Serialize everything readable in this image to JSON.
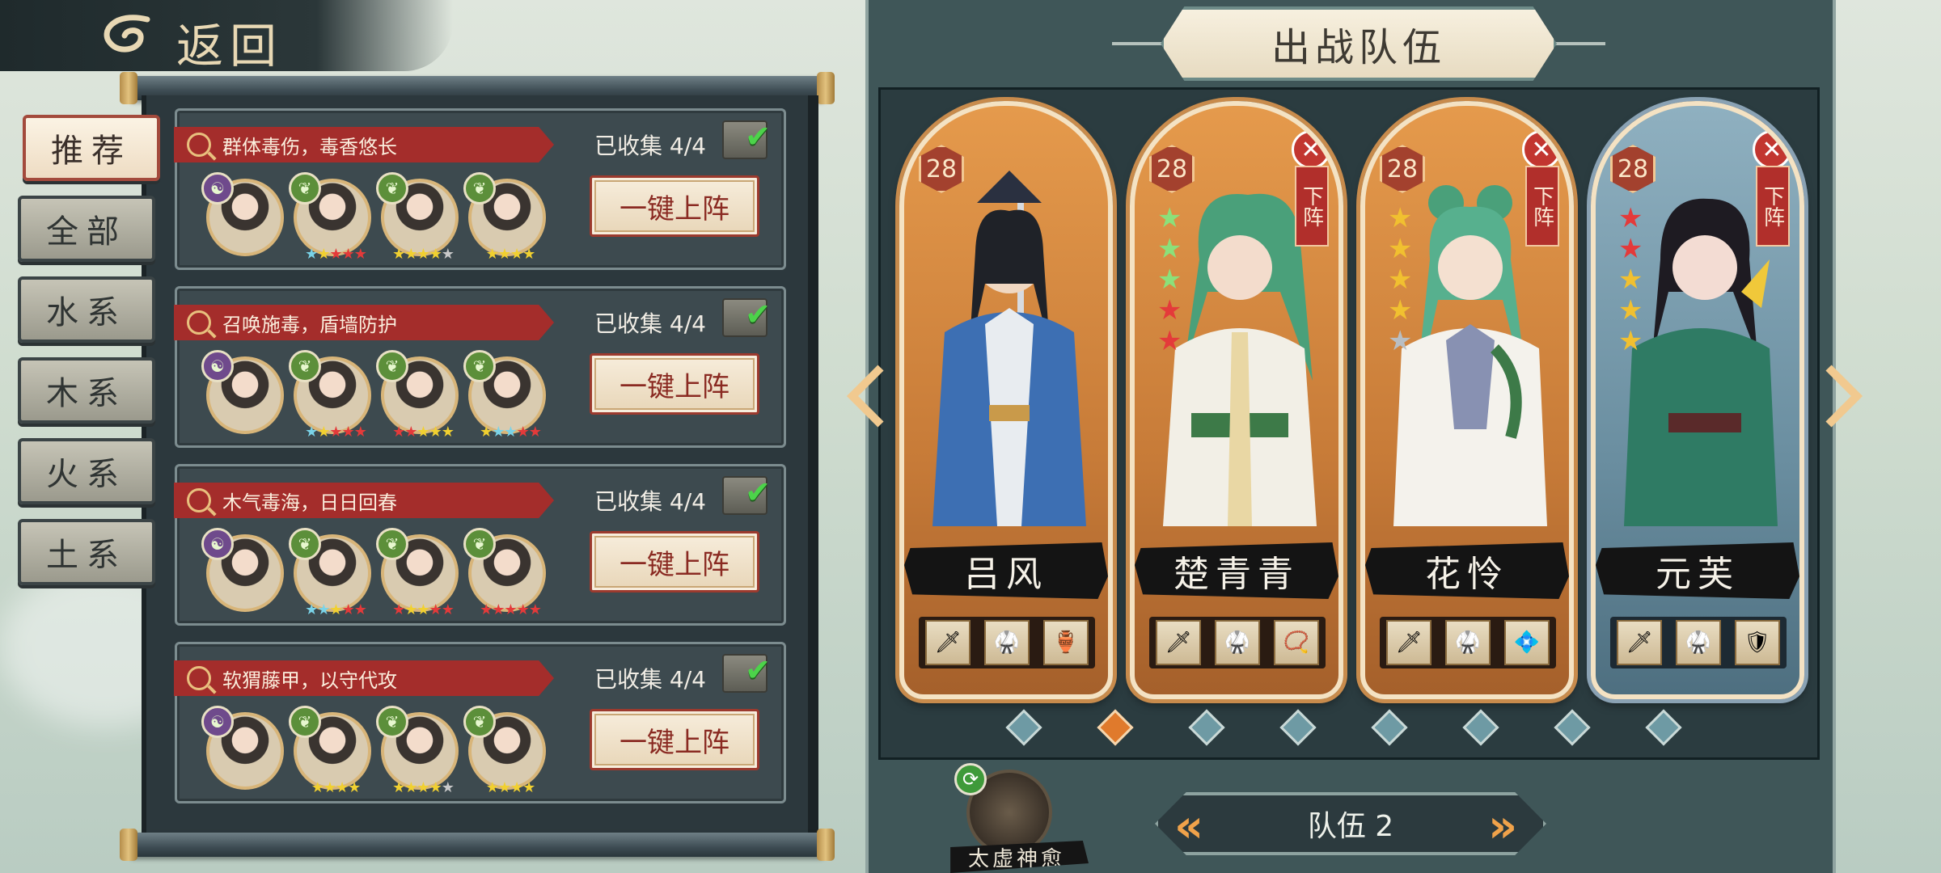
{
  "header": {
    "back_label": "返回"
  },
  "tabs": [
    {
      "label": "推荐",
      "active": true
    },
    {
      "label": "全部"
    },
    {
      "label": "水系"
    },
    {
      "label": "木系"
    },
    {
      "label": "火系"
    },
    {
      "label": "土系"
    }
  ],
  "teams": [
    {
      "title": "群体毒伤，毒香悠长",
      "collected": "已收集 4/4",
      "button": "一键上阵"
    },
    {
      "title": "召唤施毒，盾墙防护",
      "collected": "已收集 4/4",
      "button": "一键上阵"
    },
    {
      "title": "木气毒海，日日回春",
      "collected": "已收集 4/4",
      "button": "一键上阵"
    },
    {
      "title": "软猬藤甲，以守代攻",
      "collected": "已收集 4/4",
      "button": "一键上阵"
    }
  ],
  "formation": {
    "title": "出战队伍",
    "remove_label": "下阵",
    "characters": [
      {
        "name": "吕风",
        "level": "28",
        "removable": false,
        "theme": "orange"
      },
      {
        "name": "楚青青",
        "level": "28",
        "removable": true,
        "theme": "orange"
      },
      {
        "name": "花怜",
        "level": "28",
        "removable": true,
        "theme": "orange"
      },
      {
        "name": "元芙",
        "level": "28",
        "removable": true,
        "theme": "blue"
      }
    ],
    "team_label": "队伍 2",
    "skill_label": "太虚神愈",
    "page_count": 8,
    "active_page": 2
  },
  "colors": {
    "accent_red": "#a42d2b",
    "panel_dark": "#2c383d",
    "gold": "#d8b579",
    "orange_card": "#e59a4c",
    "blue_card": "#8fb0c0"
  }
}
